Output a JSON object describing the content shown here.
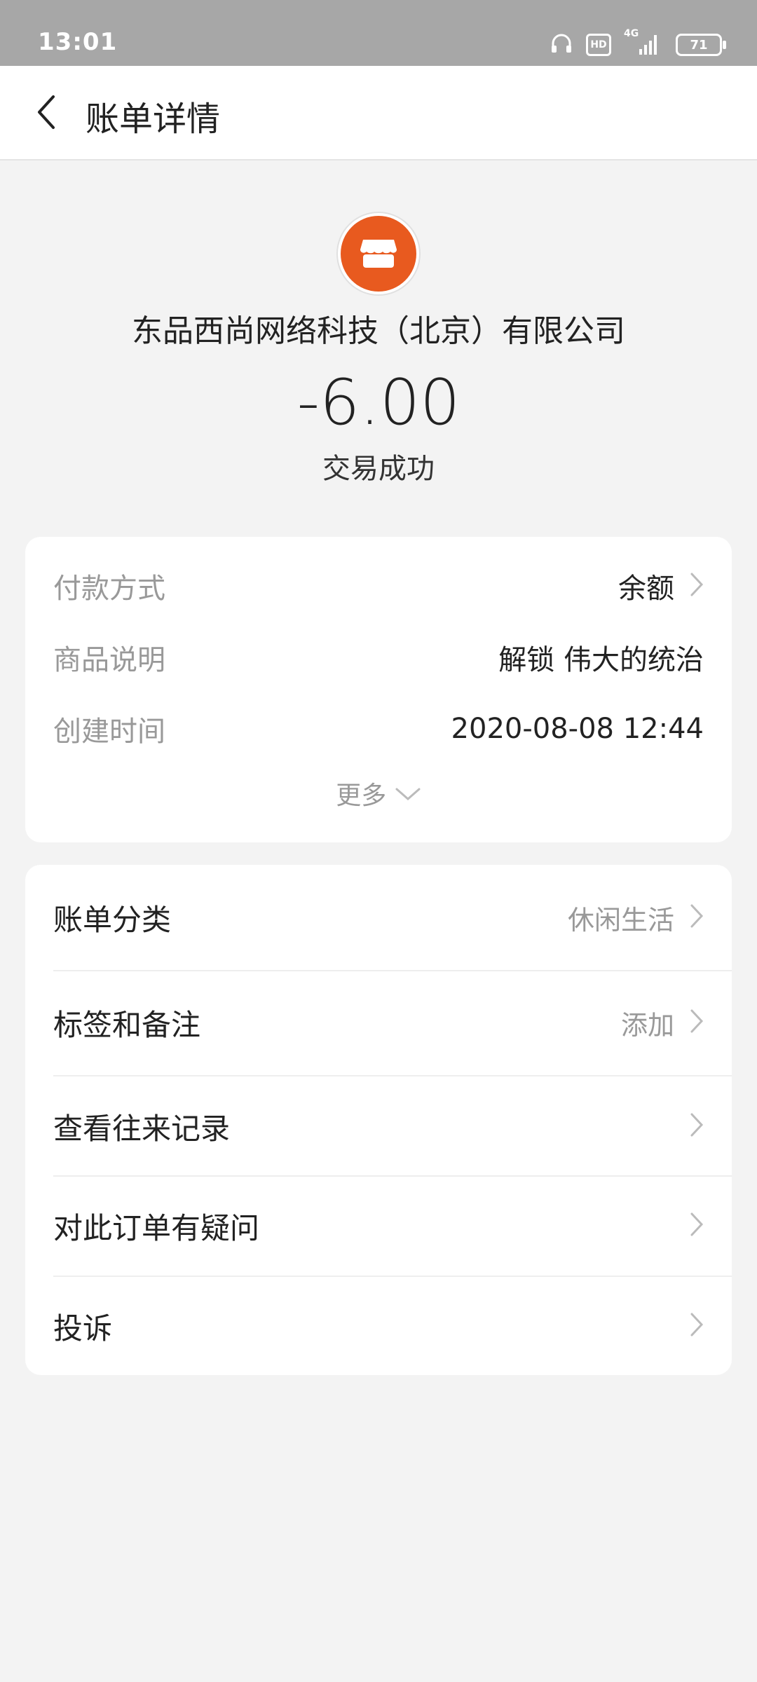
{
  "status_bar": {
    "time": "13:01",
    "network": "4G",
    "battery": "71",
    "hd": "HD"
  },
  "header": {
    "title": "账单详情"
  },
  "merchant": {
    "name": "东品西尚网络科技（北京）有限公司",
    "amount": "-6.00",
    "status": "交易成功",
    "icon": "store-icon",
    "brand_color": "#e85a1f"
  },
  "details": [
    {
      "key": "付款方式",
      "value": "余额",
      "chevron": true
    },
    {
      "key": "商品说明",
      "value": "解锁 伟大的统治",
      "chevron": false
    },
    {
      "key": "创建时间",
      "value": "2020-08-08 12:44",
      "chevron": false
    }
  ],
  "more": {
    "label": "更多"
  },
  "actions": [
    {
      "label": "账单分类",
      "value": "休闲生活"
    },
    {
      "label": "标签和备注",
      "value": "添加"
    },
    {
      "label": "查看往来记录",
      "value": ""
    },
    {
      "label": "对此订单有疑问",
      "value": ""
    },
    {
      "label": "投诉",
      "value": ""
    }
  ]
}
